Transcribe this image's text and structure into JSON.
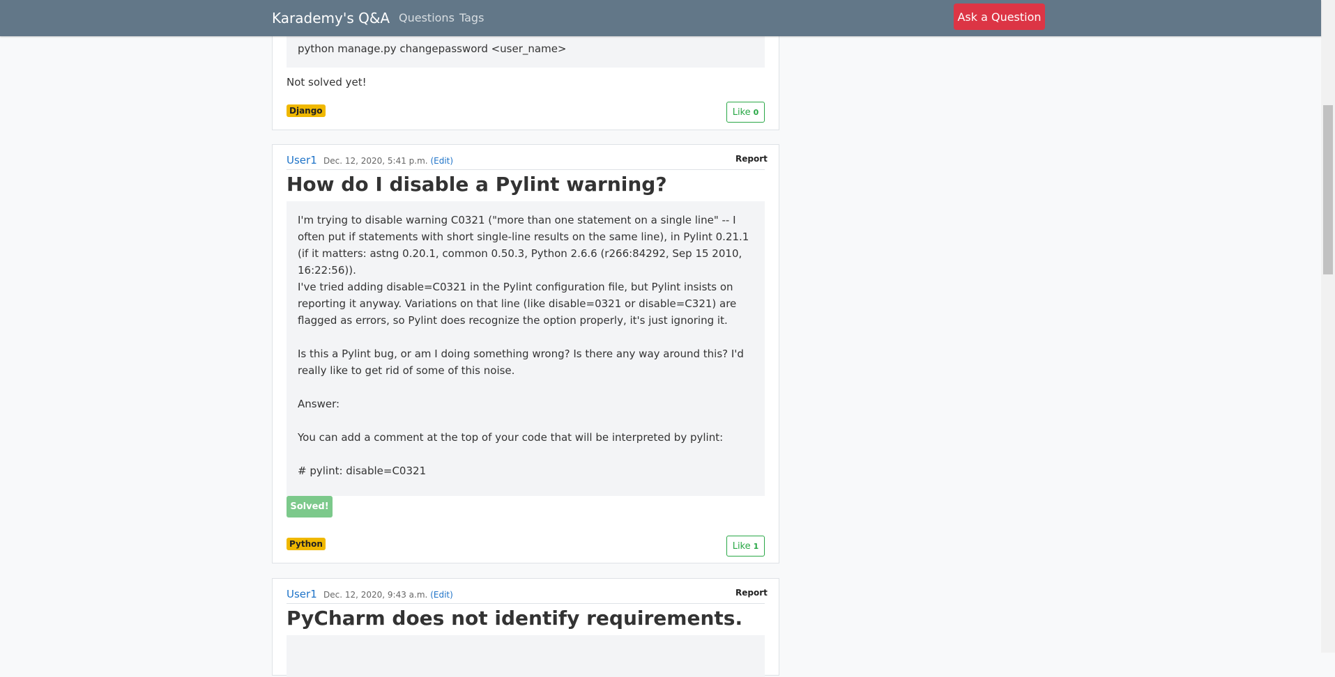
{
  "nav": {
    "brand": "Karademy's Q&A",
    "links": [
      "Questions",
      "Tags"
    ],
    "ask_button": "Ask a Question"
  },
  "card1": {
    "code": "python manage.py changepassword <user_name>",
    "status": "Not solved yet!",
    "tag": "Django",
    "like_label": "Like",
    "like_count": "0"
  },
  "card2": {
    "user": "User1",
    "date": "Dec. 12, 2020, 5:41 p.m.",
    "edit": "(Edit)",
    "report": "Report",
    "title": "How do I disable a Pylint warning?",
    "body": [
      "I'm trying to disable warning C0321 (\"more than one statement on a single line\" -- I often put if statements with short single-line results on the same line), in Pylint 0.21.1 (if it matters: astng 0.20.1, common 0.50.3, Python 2.6.6 (r266:84292, Sep 15 2010, 16:22:56)).",
      "I've tried adding disable=C0321 in the Pylint configuration file, but Pylint insists on reporting it anyway. Variations on that line (like disable=0321 or disable=C321) are flagged as errors, so Pylint does recognize the option properly, it's just ignoring it.",
      "Is this a Pylint bug, or am I doing something wrong? Is there any way around this? I'd really like to get rid of some of this noise.",
      "Answer:",
      "You can add a comment at the top of your code that will be interpreted by pylint:",
      "# pylint: disable=C0321"
    ],
    "solved": "Solved!",
    "tag": "Python",
    "like_label": "Like",
    "like_count": "1"
  },
  "card3": {
    "user": "User1",
    "date": "Dec. 12, 2020, 9:43 a.m.",
    "edit": "(Edit)",
    "report": "Report",
    "title": "PyCharm does not identify requirements."
  },
  "colors": {
    "navbar": "#627788",
    "ask_button": "#dc3545",
    "link": "#1e73c8",
    "tag": "#f0b800",
    "like": "#28a745",
    "solved": "#7cc98b"
  }
}
